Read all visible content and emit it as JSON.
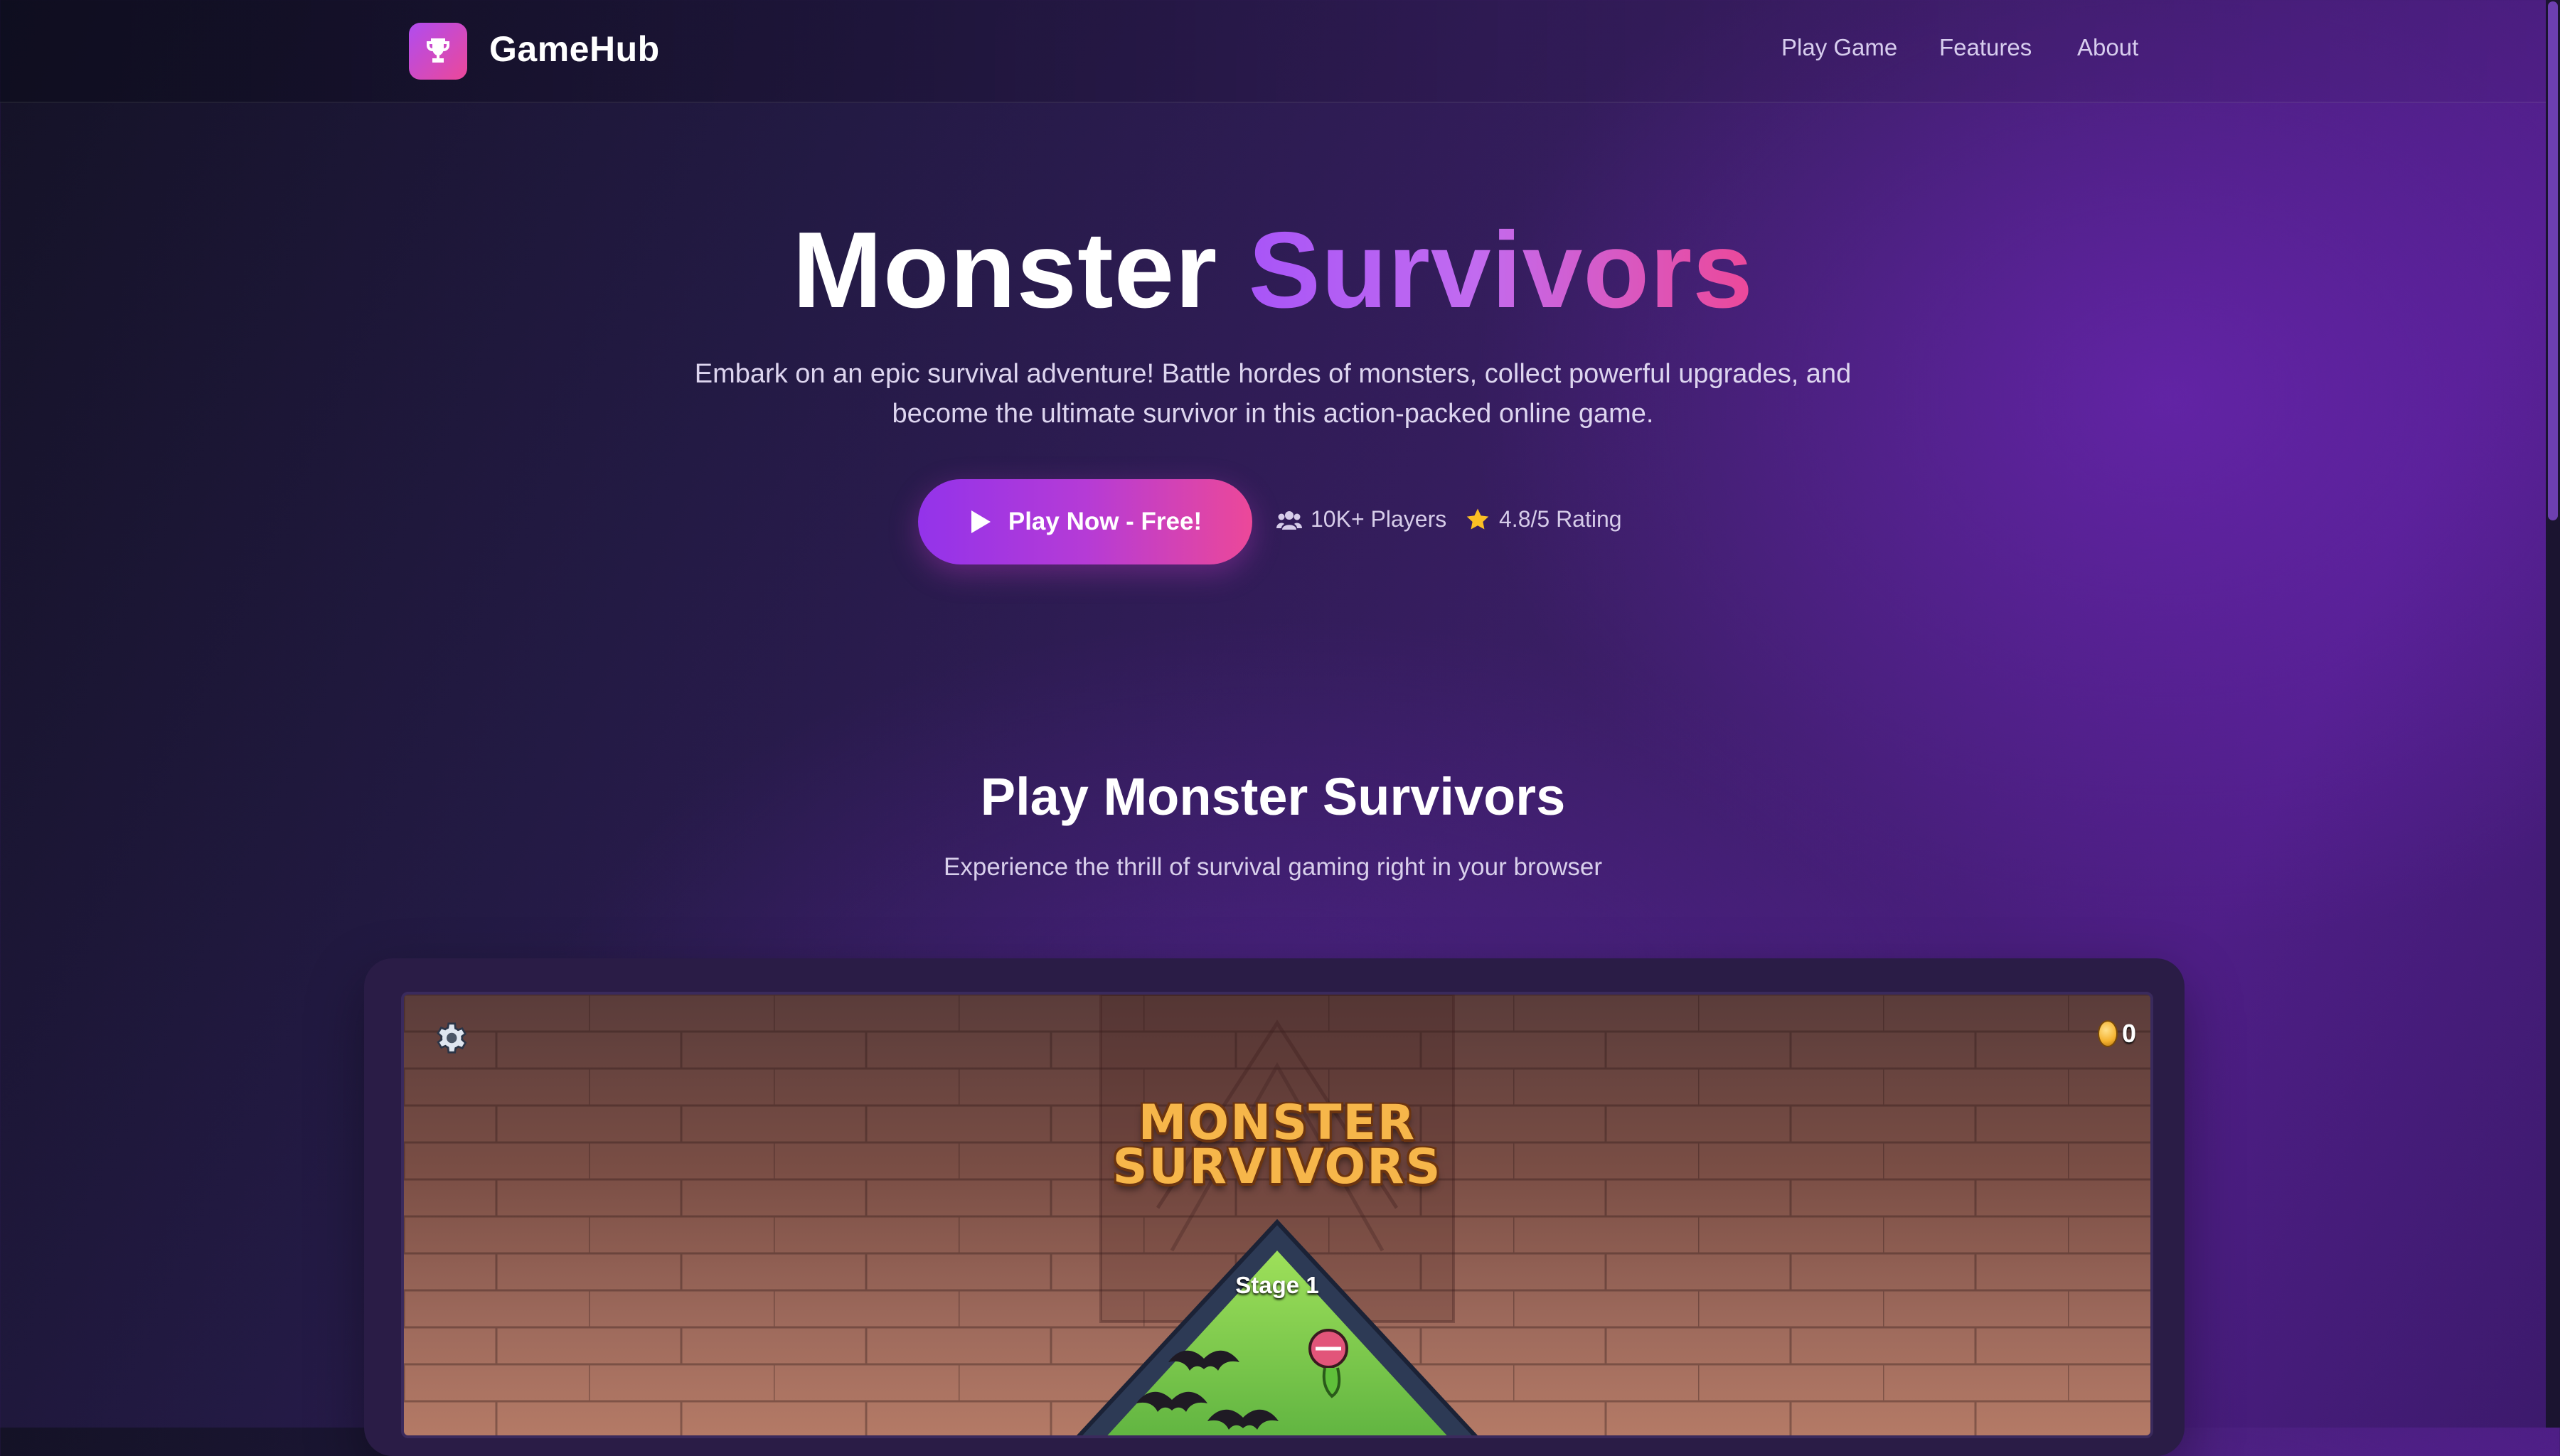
{
  "nav": {
    "brand": "GameHub",
    "links": [
      "Play Game",
      "Features",
      "About"
    ]
  },
  "hero": {
    "title_main": "Monster",
    "title_accent": "Survivors",
    "description": "Embark on an epic survival adventure! Battle hordes of monsters, collect powerful upgrades, and become the ultimate survivor in this action-packed online game.",
    "cta_label": "Play Now - Free!",
    "players_stat": "10K+ Players",
    "rating_stat": "4.8/5 Rating"
  },
  "section": {
    "title": "Play Monster Survivors",
    "subtitle": "Experience the thrill of survival gaming right in your browser"
  },
  "game": {
    "title_line1": "MONSTER",
    "title_line2": "SURVIVORS",
    "coins": "0",
    "stage": "Stage 1"
  },
  "colors": {
    "accent_purple": "#9333ea",
    "accent_pink": "#ec4899",
    "game_title": "#f6b64a"
  }
}
